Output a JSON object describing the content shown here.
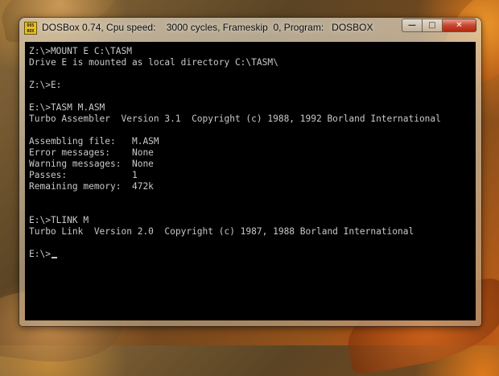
{
  "window": {
    "title": "DOSBox 0.74, Cpu speed:    3000 cycles, Frameskip  0, Program:   DOSBOX",
    "icon": "dosbox-icon",
    "icon_text": "DOS BOX",
    "controls": {
      "minimize_glyph": "—",
      "maximize_glyph": "□",
      "close_glyph": "✕"
    }
  },
  "console": {
    "lines": [
      "Z:\\>MOUNT E C:\\TASM",
      "Drive E is mounted as local directory C:\\TASM\\",
      "",
      "Z:\\>E:",
      "",
      "E:\\>TASM M.ASM",
      "Turbo Assembler  Version 3.1  Copyright (c) 1988, 1992 Borland International",
      "",
      "Assembling file:   M.ASM",
      "Error messages:    None",
      "Warning messages:  None",
      "Passes:            1",
      "Remaining memory:  472k",
      "",
      "",
      "E:\\>TLINK M",
      "Turbo Link  Version 2.0  Copyright (c) 1987, 1988 Borland International",
      "",
      "E:\\>"
    ]
  },
  "colors": {
    "console_text": "#c8c8c8",
    "console_bg": "#000000",
    "close_button": "#c84630"
  }
}
